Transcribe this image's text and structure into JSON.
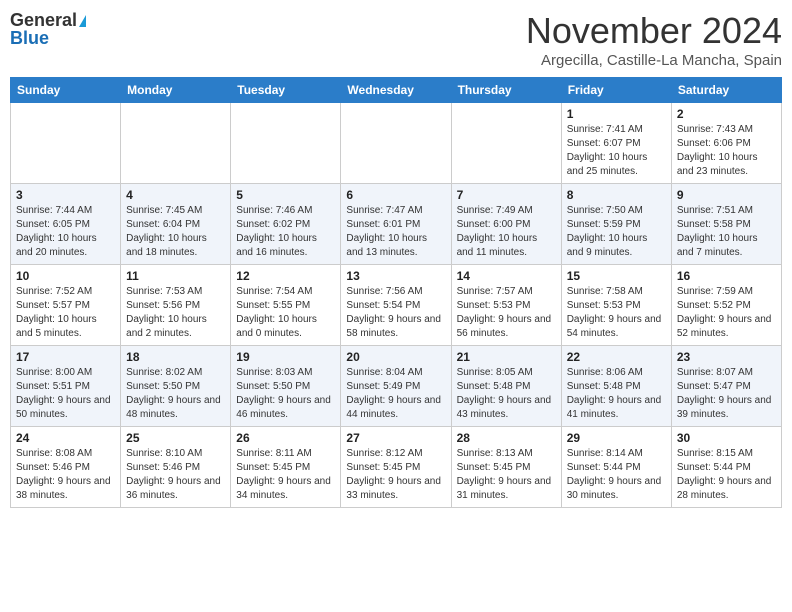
{
  "logo": {
    "general": "General",
    "blue": "Blue"
  },
  "header": {
    "month": "November 2024",
    "location": "Argecilla, Castille-La Mancha, Spain"
  },
  "weekdays": [
    "Sunday",
    "Monday",
    "Tuesday",
    "Wednesday",
    "Thursday",
    "Friday",
    "Saturday"
  ],
  "weeks": [
    [
      {
        "day": "",
        "info": ""
      },
      {
        "day": "",
        "info": ""
      },
      {
        "day": "",
        "info": ""
      },
      {
        "day": "",
        "info": ""
      },
      {
        "day": "",
        "info": ""
      },
      {
        "day": "1",
        "info": "Sunrise: 7:41 AM\nSunset: 6:07 PM\nDaylight: 10 hours and 25 minutes."
      },
      {
        "day": "2",
        "info": "Sunrise: 7:43 AM\nSunset: 6:06 PM\nDaylight: 10 hours and 23 minutes."
      }
    ],
    [
      {
        "day": "3",
        "info": "Sunrise: 7:44 AM\nSunset: 6:05 PM\nDaylight: 10 hours and 20 minutes."
      },
      {
        "day": "4",
        "info": "Sunrise: 7:45 AM\nSunset: 6:04 PM\nDaylight: 10 hours and 18 minutes."
      },
      {
        "day": "5",
        "info": "Sunrise: 7:46 AM\nSunset: 6:02 PM\nDaylight: 10 hours and 16 minutes."
      },
      {
        "day": "6",
        "info": "Sunrise: 7:47 AM\nSunset: 6:01 PM\nDaylight: 10 hours and 13 minutes."
      },
      {
        "day": "7",
        "info": "Sunrise: 7:49 AM\nSunset: 6:00 PM\nDaylight: 10 hours and 11 minutes."
      },
      {
        "day": "8",
        "info": "Sunrise: 7:50 AM\nSunset: 5:59 PM\nDaylight: 10 hours and 9 minutes."
      },
      {
        "day": "9",
        "info": "Sunrise: 7:51 AM\nSunset: 5:58 PM\nDaylight: 10 hours and 7 minutes."
      }
    ],
    [
      {
        "day": "10",
        "info": "Sunrise: 7:52 AM\nSunset: 5:57 PM\nDaylight: 10 hours and 5 minutes."
      },
      {
        "day": "11",
        "info": "Sunrise: 7:53 AM\nSunset: 5:56 PM\nDaylight: 10 hours and 2 minutes."
      },
      {
        "day": "12",
        "info": "Sunrise: 7:54 AM\nSunset: 5:55 PM\nDaylight: 10 hours and 0 minutes."
      },
      {
        "day": "13",
        "info": "Sunrise: 7:56 AM\nSunset: 5:54 PM\nDaylight: 9 hours and 58 minutes."
      },
      {
        "day": "14",
        "info": "Sunrise: 7:57 AM\nSunset: 5:53 PM\nDaylight: 9 hours and 56 minutes."
      },
      {
        "day": "15",
        "info": "Sunrise: 7:58 AM\nSunset: 5:53 PM\nDaylight: 9 hours and 54 minutes."
      },
      {
        "day": "16",
        "info": "Sunrise: 7:59 AM\nSunset: 5:52 PM\nDaylight: 9 hours and 52 minutes."
      }
    ],
    [
      {
        "day": "17",
        "info": "Sunrise: 8:00 AM\nSunset: 5:51 PM\nDaylight: 9 hours and 50 minutes."
      },
      {
        "day": "18",
        "info": "Sunrise: 8:02 AM\nSunset: 5:50 PM\nDaylight: 9 hours and 48 minutes."
      },
      {
        "day": "19",
        "info": "Sunrise: 8:03 AM\nSunset: 5:50 PM\nDaylight: 9 hours and 46 minutes."
      },
      {
        "day": "20",
        "info": "Sunrise: 8:04 AM\nSunset: 5:49 PM\nDaylight: 9 hours and 44 minutes."
      },
      {
        "day": "21",
        "info": "Sunrise: 8:05 AM\nSunset: 5:48 PM\nDaylight: 9 hours and 43 minutes."
      },
      {
        "day": "22",
        "info": "Sunrise: 8:06 AM\nSunset: 5:48 PM\nDaylight: 9 hours and 41 minutes."
      },
      {
        "day": "23",
        "info": "Sunrise: 8:07 AM\nSunset: 5:47 PM\nDaylight: 9 hours and 39 minutes."
      }
    ],
    [
      {
        "day": "24",
        "info": "Sunrise: 8:08 AM\nSunset: 5:46 PM\nDaylight: 9 hours and 38 minutes."
      },
      {
        "day": "25",
        "info": "Sunrise: 8:10 AM\nSunset: 5:46 PM\nDaylight: 9 hours and 36 minutes."
      },
      {
        "day": "26",
        "info": "Sunrise: 8:11 AM\nSunset: 5:45 PM\nDaylight: 9 hours and 34 minutes."
      },
      {
        "day": "27",
        "info": "Sunrise: 8:12 AM\nSunset: 5:45 PM\nDaylight: 9 hours and 33 minutes."
      },
      {
        "day": "28",
        "info": "Sunrise: 8:13 AM\nSunset: 5:45 PM\nDaylight: 9 hours and 31 minutes."
      },
      {
        "day": "29",
        "info": "Sunrise: 8:14 AM\nSunset: 5:44 PM\nDaylight: 9 hours and 30 minutes."
      },
      {
        "day": "30",
        "info": "Sunrise: 8:15 AM\nSunset: 5:44 PM\nDaylight: 9 hours and 28 minutes."
      }
    ]
  ]
}
